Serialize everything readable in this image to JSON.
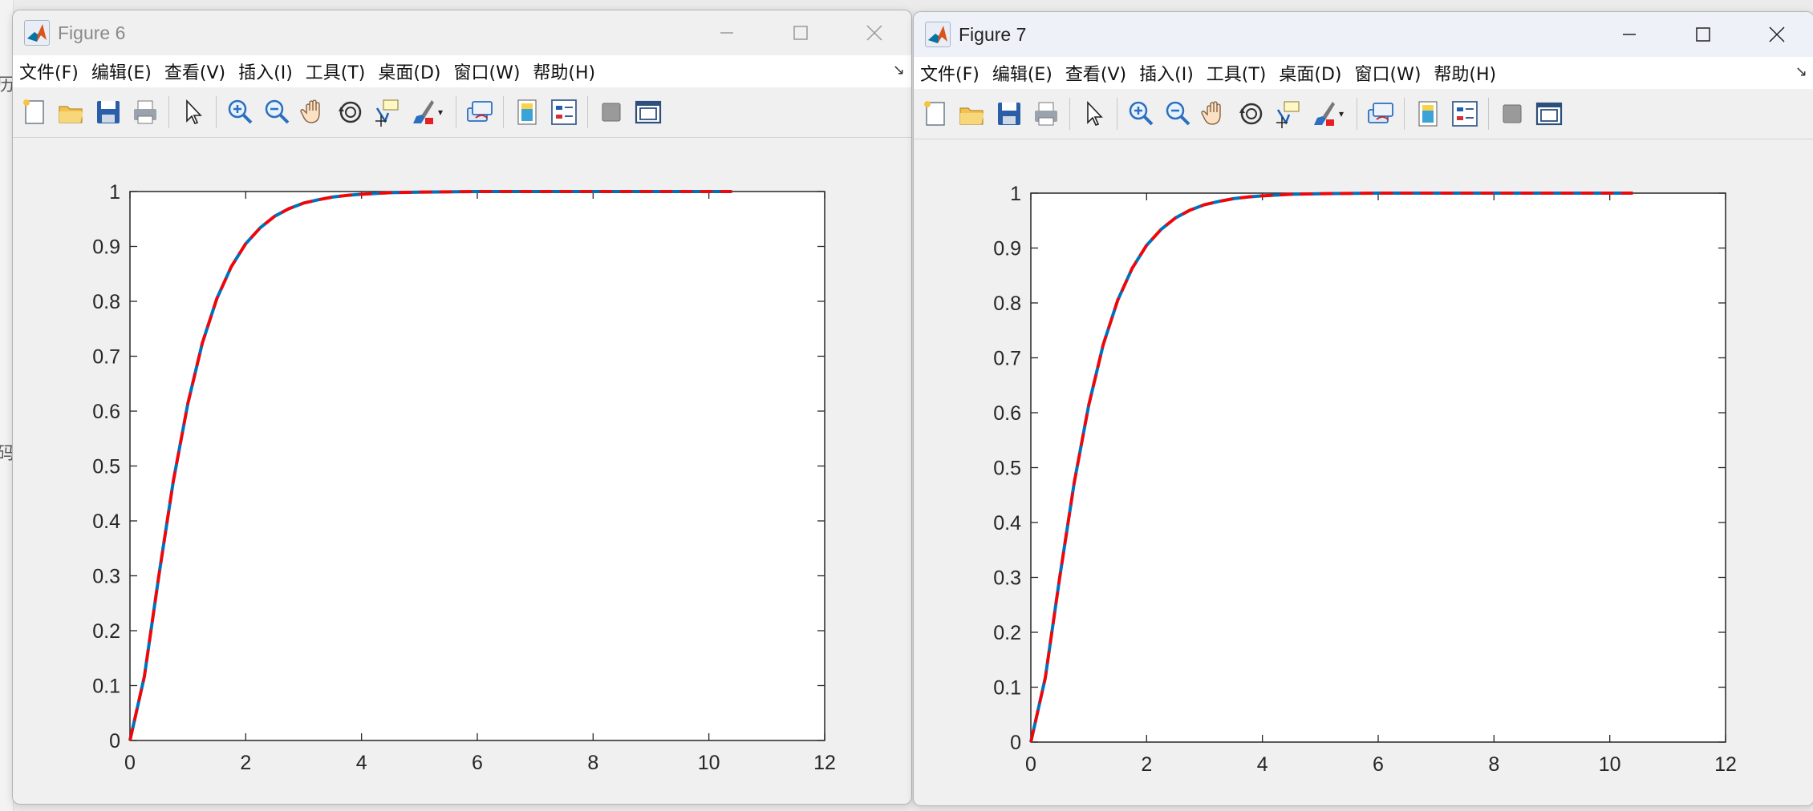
{
  "desktop": {
    "edge_glyphs": [
      "历",
      "码"
    ]
  },
  "menu": [
    "文件(F)",
    "编辑(E)",
    "查看(V)",
    "插入(I)",
    "工具(T)",
    "桌面(D)",
    "窗口(W)",
    "帮助(H)"
  ],
  "toolbar_icons": [
    "new-figure-icon",
    "open-file-icon",
    "save-icon",
    "print-icon",
    "edit-plot-arrow-icon",
    "zoom-in-icon",
    "zoom-out-icon",
    "pan-hand-icon",
    "rotate-3d-icon",
    "data-cursor-icon",
    "brush-icon",
    "link-plot-icon",
    "insert-colorbar-icon",
    "insert-legend-icon",
    "hide-plot-tools-icon",
    "show-plot-tools-icon"
  ],
  "colors": {
    "line_blue": "#0072BD",
    "line_red_dashed": "#FF0000",
    "axes_bg": "#ffffff",
    "figure_bg": "#f0f0f0"
  },
  "figures": [
    {
      "title": "Figure 6",
      "active": false,
      "chart_data": {
        "type": "line",
        "title": "",
        "xlabel": "",
        "ylabel": "",
        "xlim": [
          0,
          12
        ],
        "ylim": [
          0,
          1
        ],
        "xticks": [
          "0",
          "2",
          "4",
          "6",
          "8",
          "10",
          "12"
        ],
        "yticks": [
          "0",
          "0.1",
          "0.2",
          "0.3",
          "0.4",
          "0.5",
          "0.6",
          "0.7",
          "0.8",
          "0.9",
          "1"
        ],
        "grid": false,
        "series": [
          {
            "style": "solid",
            "color": "#0072BD",
            "x": [
              0,
              0.25,
              0.5,
              0.75,
              1,
              1.25,
              1.5,
              1.75,
              2,
              2.25,
              2.5,
              2.75,
              3,
              3.25,
              3.5,
              3.75,
              4,
              4.5,
              5,
              6,
              7,
              8,
              9,
              10,
              10.4
            ],
            "y": [
              0,
              0.117,
              0.301,
              0.473,
              0.614,
              0.724,
              0.805,
              0.863,
              0.905,
              0.934,
              0.955,
              0.969,
              0.979,
              0.985,
              0.99,
              0.993,
              0.995,
              0.998,
              0.999,
              1,
              1,
              1,
              1,
              1,
              1
            ]
          },
          {
            "style": "dashed",
            "color": "#FF0000",
            "x": [
              0,
              0.25,
              0.5,
              0.75,
              1,
              1.25,
              1.5,
              1.75,
              2,
              2.25,
              2.5,
              2.75,
              3,
              3.25,
              3.5,
              3.75,
              4,
              4.5,
              5,
              6,
              7,
              8,
              9,
              10,
              10.4
            ],
            "y": [
              0,
              0.117,
              0.301,
              0.473,
              0.614,
              0.724,
              0.805,
              0.863,
              0.905,
              0.934,
              0.955,
              0.969,
              0.979,
              0.985,
              0.99,
              0.993,
              0.995,
              0.998,
              0.999,
              1,
              1,
              1,
              1,
              1,
              1
            ]
          }
        ]
      }
    },
    {
      "title": "Figure 7",
      "active": true,
      "chart_data": {
        "type": "line",
        "title": "",
        "xlabel": "",
        "ylabel": "",
        "xlim": [
          0,
          12
        ],
        "ylim": [
          0,
          1
        ],
        "xticks": [
          "0",
          "2",
          "4",
          "6",
          "8",
          "10",
          "12"
        ],
        "yticks": [
          "0",
          "0.1",
          "0.2",
          "0.3",
          "0.4",
          "0.5",
          "0.6",
          "0.7",
          "0.8",
          "0.9",
          "1"
        ],
        "grid": false,
        "series": [
          {
            "style": "solid",
            "color": "#0072BD",
            "x": [
              0,
              0.25,
              0.5,
              0.75,
              1,
              1.25,
              1.5,
              1.75,
              2,
              2.25,
              2.5,
              2.75,
              3,
              3.25,
              3.5,
              3.75,
              4,
              4.5,
              5,
              6,
              7,
              8,
              9,
              10,
              10.4
            ],
            "y": [
              0,
              0.117,
              0.301,
              0.473,
              0.614,
              0.724,
              0.805,
              0.863,
              0.905,
              0.934,
              0.955,
              0.969,
              0.979,
              0.985,
              0.99,
              0.993,
              0.995,
              0.998,
              0.999,
              1,
              1,
              1,
              1,
              1,
              1
            ]
          },
          {
            "style": "dashed",
            "color": "#FF0000",
            "x": [
              0,
              0.25,
              0.5,
              0.75,
              1,
              1.25,
              1.5,
              1.75,
              2,
              2.25,
              2.5,
              2.75,
              3,
              3.25,
              3.5,
              3.75,
              4,
              4.5,
              5,
              6,
              7,
              8,
              9,
              10,
              10.4
            ],
            "y": [
              0,
              0.117,
              0.301,
              0.473,
              0.614,
              0.724,
              0.805,
              0.863,
              0.905,
              0.934,
              0.955,
              0.969,
              0.979,
              0.985,
              0.99,
              0.993,
              0.995,
              0.998,
              0.999,
              1,
              1,
              1,
              1,
              1,
              1
            ]
          }
        ]
      }
    }
  ]
}
